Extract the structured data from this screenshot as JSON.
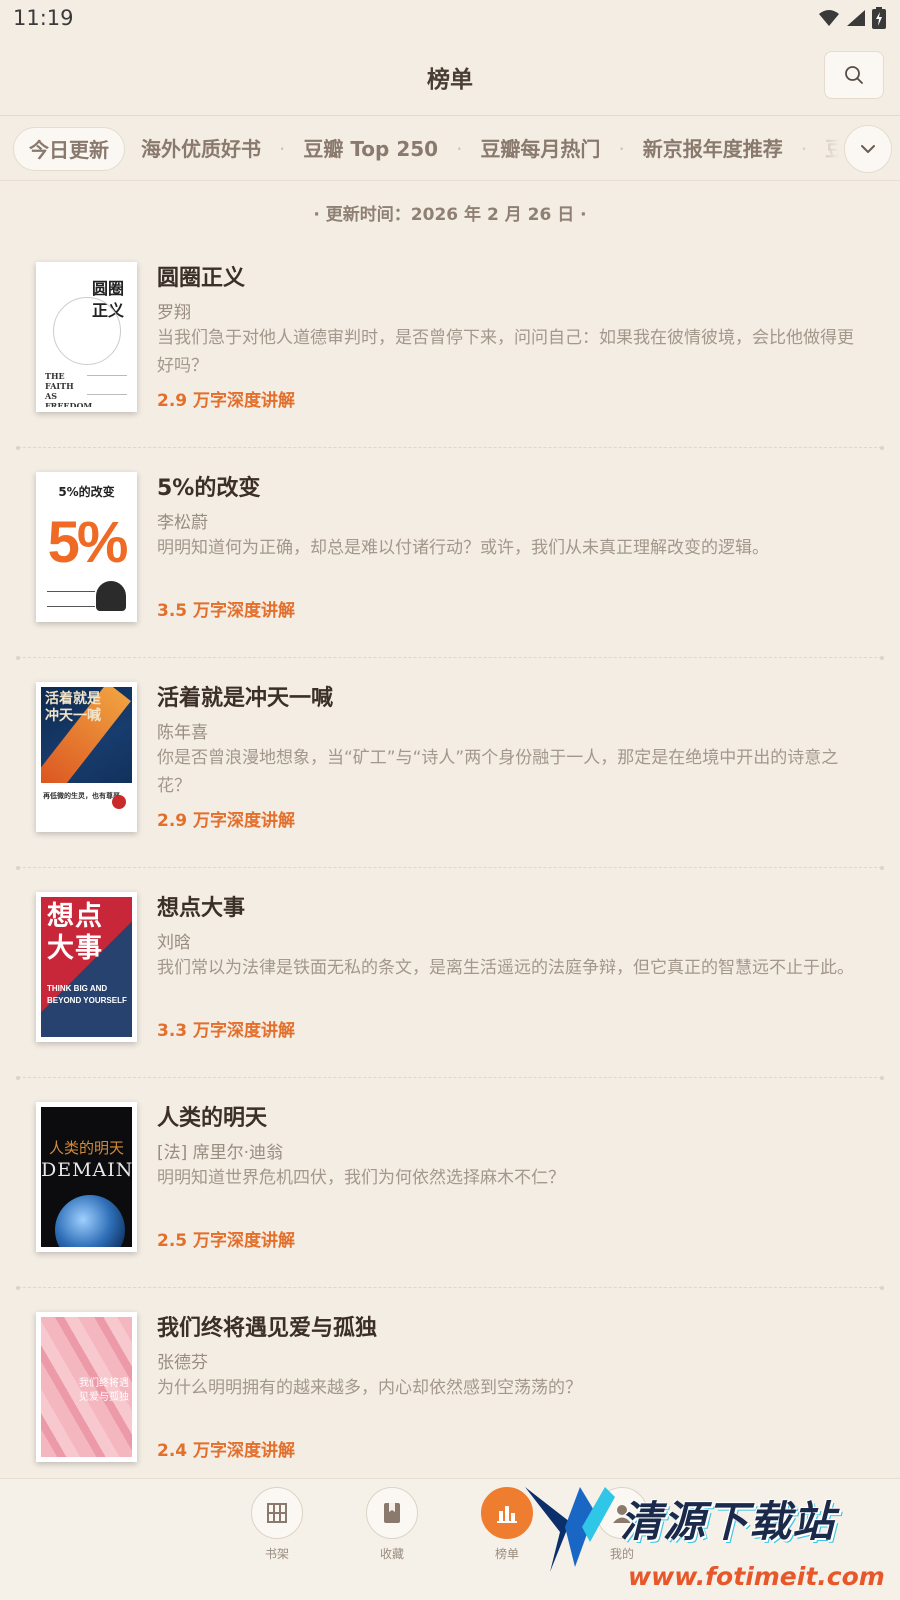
{
  "status_bar": {
    "time": "11:19"
  },
  "header": {
    "title": "榜单"
  },
  "tabs": [
    {
      "label": "今日更新",
      "active": true
    },
    {
      "label": "海外优质好书"
    },
    {
      "label": "豆瓣 Top 250"
    },
    {
      "label": "豆瓣每月热门"
    },
    {
      "label": "新京报年度推荐"
    },
    {
      "label": "豆"
    }
  ],
  "update_time": "· 更新时间：2026 年 2 月 26 日 ·",
  "books": [
    {
      "title": "圆圈正义",
      "author": "罗翔",
      "description": "当我们急于对他人道德审判时，是否曾停下来，问问自己：如果我在彼情彼境，会比他做得更好吗？",
      "length": "2.9 万字深度讲解",
      "cover": {
        "text1": "圆圈",
        "text2": "正义",
        "text3": "THE FAITH AS FREEDOM"
      }
    },
    {
      "title": "5%的改变",
      "author": "李松蔚",
      "description": "明明知道何为正确，却总是难以付诸行动？或许，我们从未真正理解改变的逻辑。",
      "length": "3.5 万字深度讲解",
      "cover": {
        "text1": "5%的改变",
        "text2": "5%"
      }
    },
    {
      "title": "活着就是冲天一喊",
      "author": "陈年喜",
      "description": "你是否曾浪漫地想象，当“矿工”与“诗人”两个身份融于一人，那定是在绝境中开出的诗意之花？",
      "length": "2.9 万字深度讲解",
      "cover": {
        "text1": "活着就是冲天一喊",
        "text2": "再低微的生灵，也有尊严"
      }
    },
    {
      "title": "想点大事",
      "author": "刘晗",
      "description": "我们常以为法律是铁面无私的条文，是离生活遥远的法庭争辩，但它真正的智慧远不止于此。",
      "length": "3.3 万字深度讲解",
      "cover": {
        "text1": "想点大事",
        "text2": "THINK BIG AND BEYOND YOURSELF"
      }
    },
    {
      "title": "人类的明天",
      "author": "[法] 席里尔·迪翁",
      "description": "明明知道世界危机四伏，我们为何依然选择麻木不仁？",
      "length": "2.5 万字深度讲解",
      "cover": {
        "text1": "人类的明天",
        "text2": "DEMAIN"
      }
    },
    {
      "title": "我们终将遇见爱与孤独",
      "author": "张德芬",
      "description": "为什么明明拥有的越来越多，内心却依然感到空荡荡的？",
      "length": "2.4 万字深度讲解",
      "cover": {
        "text1": "我们终将遇见爱与孤独"
      }
    }
  ],
  "bottom_nav": [
    {
      "label": "书架",
      "icon": "bookshelf-icon"
    },
    {
      "label": "收藏",
      "icon": "bookmark-icon"
    },
    {
      "label": "榜单",
      "icon": "ranking-icon",
      "active": true
    },
    {
      "label": "我的",
      "icon": "profile-icon"
    }
  ],
  "watermark": {
    "title": "清源下载站",
    "url": "www.fotimeit.com"
  },
  "colors": {
    "accent": "#e36f2c",
    "background": "#f3ede4"
  }
}
